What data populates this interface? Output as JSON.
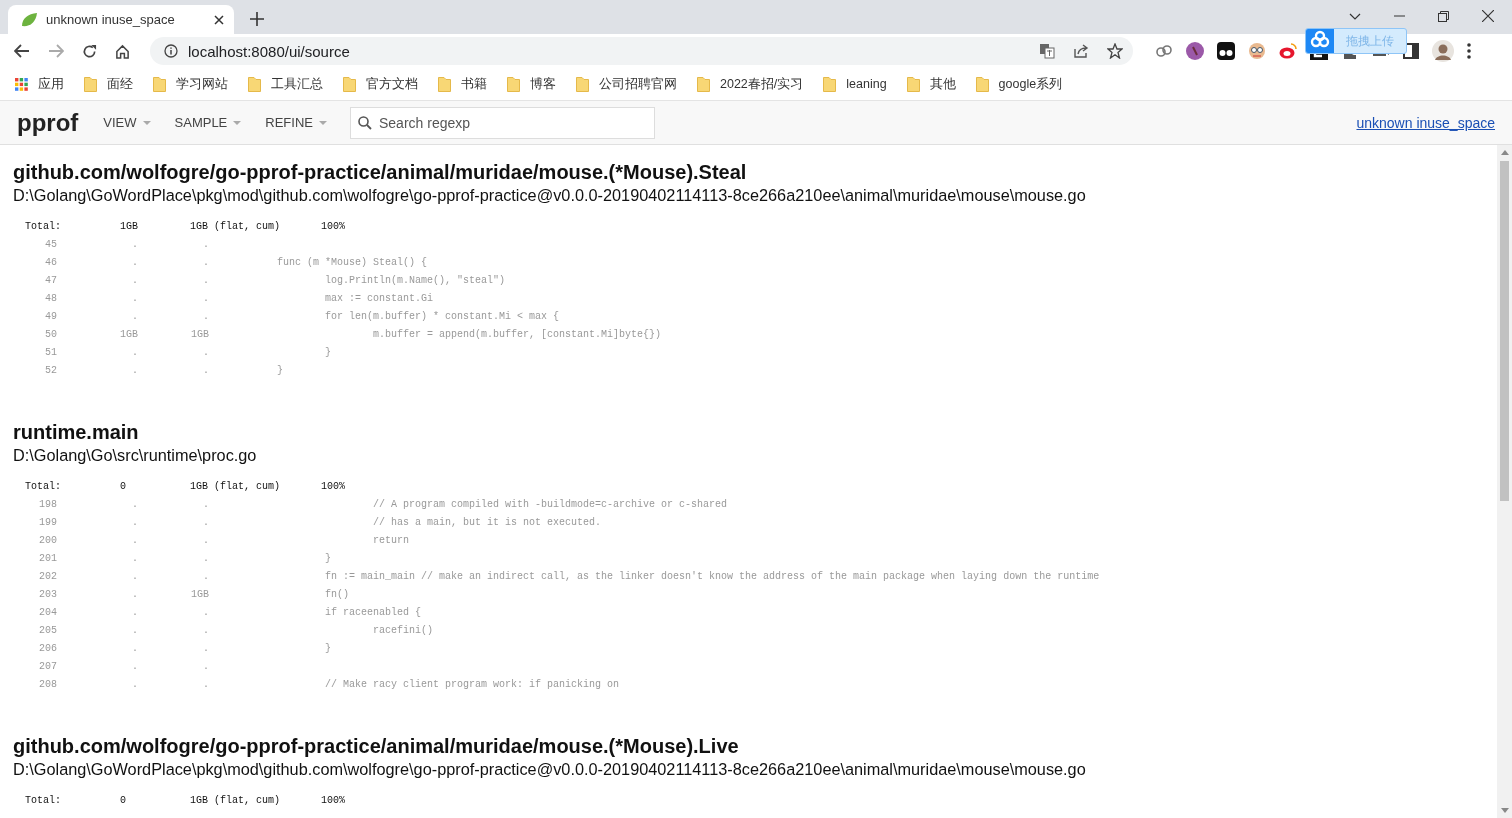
{
  "browser": {
    "tabs": [
      {
        "title": "unknown inuse_space",
        "selected": true
      }
    ],
    "address": "localhost:8080/ui/source",
    "upload_widget": "拖拽上传",
    "bookmarks": [
      {
        "label": "应用",
        "kind": "apps"
      },
      {
        "label": "面经",
        "kind": "folder"
      },
      {
        "label": "学习网站",
        "kind": "folder"
      },
      {
        "label": "工具汇总",
        "kind": "folder"
      },
      {
        "label": "官方文档",
        "kind": "folder"
      },
      {
        "label": "书籍",
        "kind": "folder"
      },
      {
        "label": "博客",
        "kind": "folder"
      },
      {
        "label": "公司招聘官网",
        "kind": "folder"
      },
      {
        "label": "2022春招/实习",
        "kind": "folder"
      },
      {
        "label": "leaning",
        "kind": "folder"
      },
      {
        "label": "其他",
        "kind": "folder"
      },
      {
        "label": "google系列",
        "kind": "folder"
      }
    ]
  },
  "toolbar": {
    "logo": "pprof",
    "menus": [
      "VIEW",
      "SAMPLE",
      "REFINE"
    ],
    "search": {
      "placeholder": "Search regexp"
    },
    "profile_link": "unknown inuse_space"
  },
  "sections": [
    {
      "function": "github.com/wolfogre/go-pprof-practice/animal/muridae/mouse.(*Mouse).Steal",
      "file": "D:\\Golang\\GoWordPlace\\pkg\\mod\\github.com\\wolfogre\\go-pprof-practice@v0.0.0-20190402114113-8ce266a210ee\\animal\\muridae\\mouse\\mouse.go",
      "total": {
        "label": "Total:",
        "flat": "1GB",
        "cum": "1GB",
        "legend": "(flat, cum)",
        "percent": "100%"
      },
      "lines": [
        {
          "number": "45",
          "flat": ".",
          "cum": "."
        },
        {
          "number": "46",
          "flat": ".",
          "cum": ".",
          "code": "\tfunc (m *Mouse) Steal() {"
        },
        {
          "number": "47",
          "flat": ".",
          "cum": ".",
          "code": "\t\tlog.Println(m.Name(), \"steal\")"
        },
        {
          "number": "48",
          "flat": ".",
          "cum": ".",
          "code": "\t\tmax := constant.Gi"
        },
        {
          "number": "49",
          "flat": ".",
          "cum": ".",
          "code": "\t\tfor len(m.buffer) * constant.Mi < max {"
        },
        {
          "number": "50",
          "flat": "1GB",
          "cum": "1GB",
          "code": "\t\t\tm.buffer = append(m.buffer, [constant.Mi]byte{})"
        },
        {
          "number": "51",
          "flat": ".",
          "cum": ".",
          "code": "\t\t}"
        },
        {
          "number": "52",
          "flat": ".",
          "cum": ".",
          "code": "\t}"
        }
      ]
    },
    {
      "function": "runtime.main",
      "file": "D:\\Golang\\Go\\src\\runtime\\proc.go",
      "total": {
        "label": "Total:",
        "flat": "0",
        "cum": "1GB",
        "legend": "(flat, cum)",
        "percent": "100%"
      },
      "lines": [
        {
          "number": "198",
          "flat": ".",
          "cum": ".",
          "code": "\t\t\t// A program compiled with -buildmode=c-archive or c-shared"
        },
        {
          "number": "199",
          "flat": ".",
          "cum": ".",
          "code": "\t\t\t// has a main, but it is not executed."
        },
        {
          "number": "200",
          "flat": ".",
          "cum": ".",
          "code": "\t\t\treturn"
        },
        {
          "number": "201",
          "flat": ".",
          "cum": ".",
          "code": "\t\t}"
        },
        {
          "number": "202",
          "flat": ".",
          "cum": ".",
          "code": "\t\tfn := main_main // make an indirect call, as the linker doesn't know the address of the main package when laying down the runtime"
        },
        {
          "number": "203",
          "flat": ".",
          "cum": "1GB",
          "code": "\t\tfn()"
        },
        {
          "number": "204",
          "flat": ".",
          "cum": ".",
          "code": "\t\tif raceenabled {"
        },
        {
          "number": "205",
          "flat": ".",
          "cum": ".",
          "code": "\t\t\tracefini()"
        },
        {
          "number": "206",
          "flat": ".",
          "cum": ".",
          "code": "\t\t}"
        },
        {
          "number": "207",
          "flat": ".",
          "cum": "."
        },
        {
          "number": "208",
          "flat": ".",
          "cum": ".",
          "code": "\t\t// Make racy client program work: if panicking on"
        }
      ]
    },
    {
      "function": "github.com/wolfogre/go-pprof-practice/animal/muridae/mouse.(*Mouse).Live",
      "file": "D:\\Golang\\GoWordPlace\\pkg\\mod\\github.com\\wolfogre\\go-pprof-practice@v0.0.0-20190402114113-8ce266a210ee\\animal\\muridae\\mouse\\mouse.go",
      "total": {
        "label": "Total:",
        "flat": "0",
        "cum": "1GB",
        "legend": "(flat, cum)",
        "percent": "100%"
      }
    }
  ]
}
